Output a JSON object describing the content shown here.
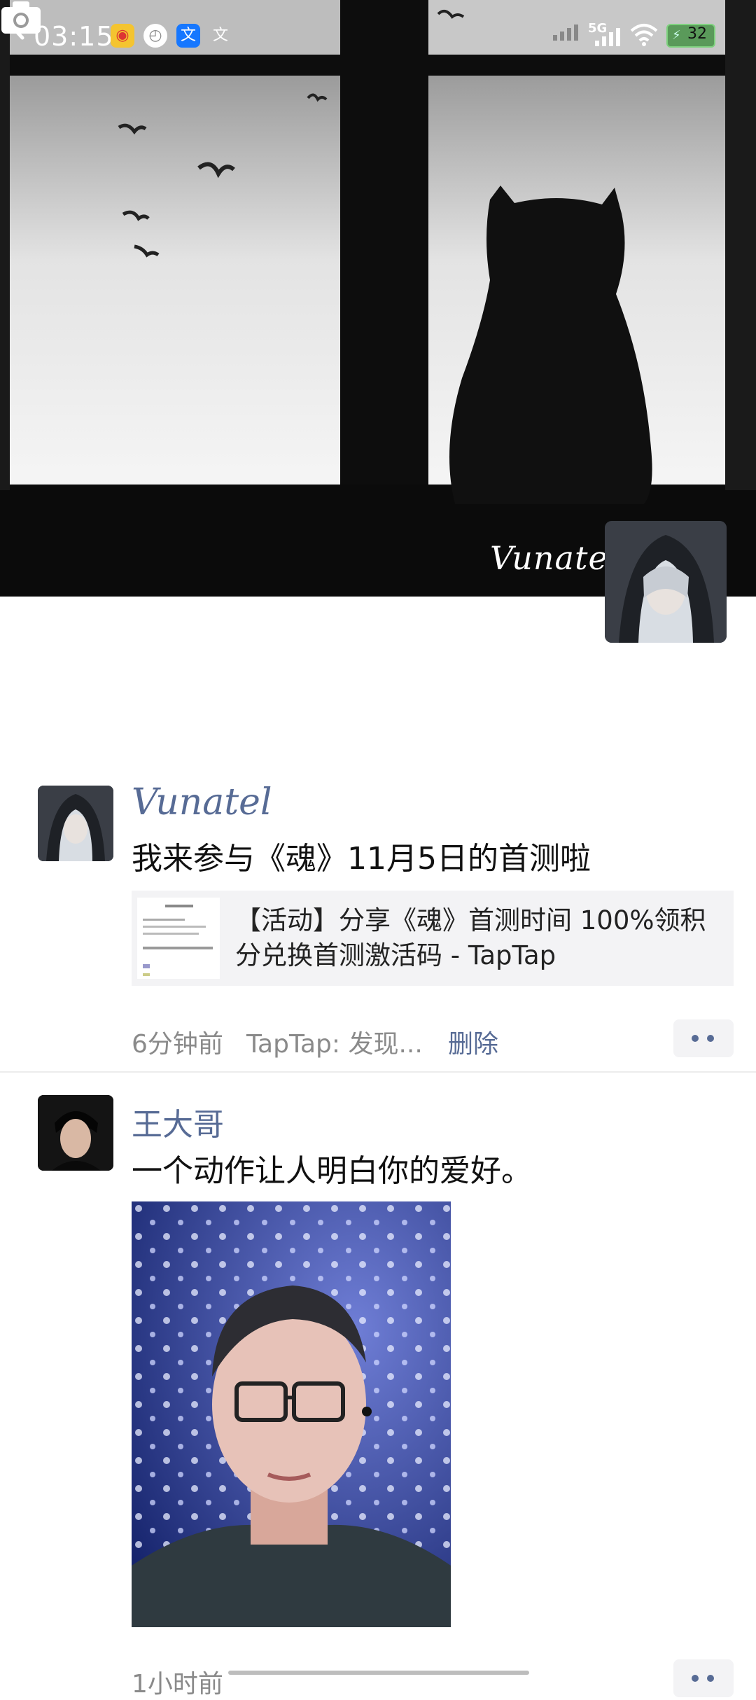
{
  "status_bar": {
    "time": "03:15",
    "network": "5G",
    "battery": "32"
  },
  "nav": {
    "back_icon": "chevron-left-icon",
    "camera_icon": "camera-icon"
  },
  "profile": {
    "cover_name": "Vunatel"
  },
  "posts": [
    {
      "username": "Vunatel",
      "text": "我来参与《魂》11月5日的首测啦",
      "link_title": "【活动】分享《魂》首测时间 100%领积分兑换首测激活码 - TapTap",
      "time": "6分钟前",
      "source": "TapTap: 发现...",
      "delete_label": "删除"
    },
    {
      "username": "王大哥",
      "text": "一个动作让人明白你的爱好。",
      "time": "1小时前"
    }
  ],
  "colors": {
    "link_blue": "#576b95",
    "card_bg": "#f3f3f5"
  }
}
